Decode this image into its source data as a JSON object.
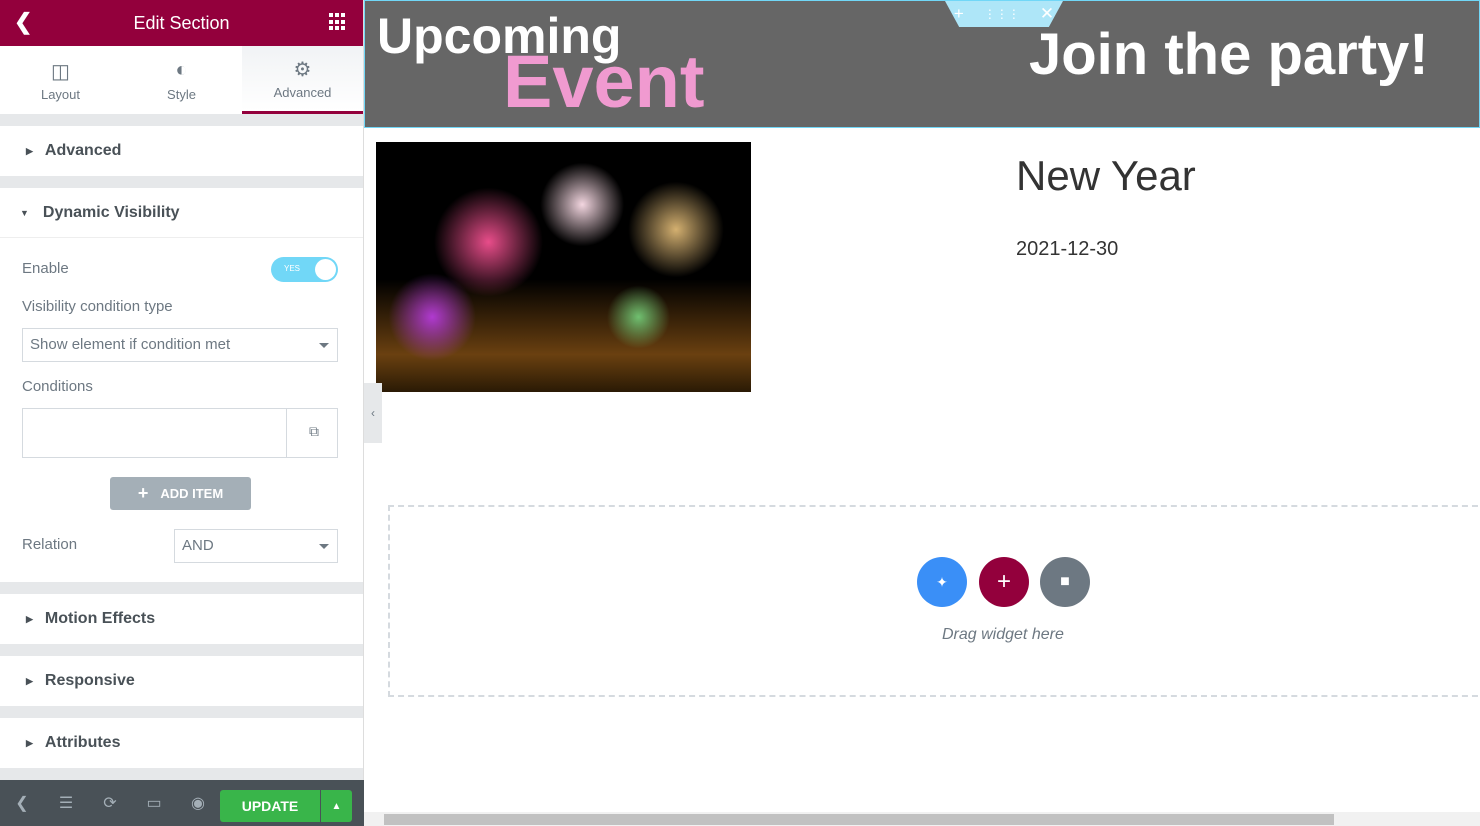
{
  "header": {
    "title": "Edit Section",
    "back_icon": "chevron-left-icon",
    "apps_icon": "grid-icon"
  },
  "tabs": [
    {
      "label": "Layout",
      "icon": "columns-icon"
    },
    {
      "label": "Style",
      "icon": "half-circle-icon"
    },
    {
      "label": "Advanced",
      "icon": "gear-icon",
      "active": true
    }
  ],
  "sections": {
    "advanced": "Advanced",
    "dynamic_visibility": "Dynamic Visibility",
    "motion": "Motion Effects",
    "responsive": "Responsive",
    "attributes": "Attributes"
  },
  "dynamic": {
    "enable_label": "Enable",
    "toggle": "YES",
    "type_label": "Visibility condition type",
    "type_value": "Show element if condition met",
    "conditions_label": "Conditions",
    "add_item": "ADD ITEM",
    "relation_label": "Relation",
    "relation_value": "AND"
  },
  "footer": {
    "update": "UPDATE"
  },
  "canvas": {
    "upcoming": "Upcoming",
    "event": "Event",
    "join": "Join the party!",
    "title": "New Year",
    "date": "2021-12-30",
    "drag": "Drag widget here"
  },
  "colors": {
    "brand": "#93003c",
    "update": "#39b54a",
    "accent_pink": "#f09ad0",
    "blue": "#3a8ff7"
  }
}
